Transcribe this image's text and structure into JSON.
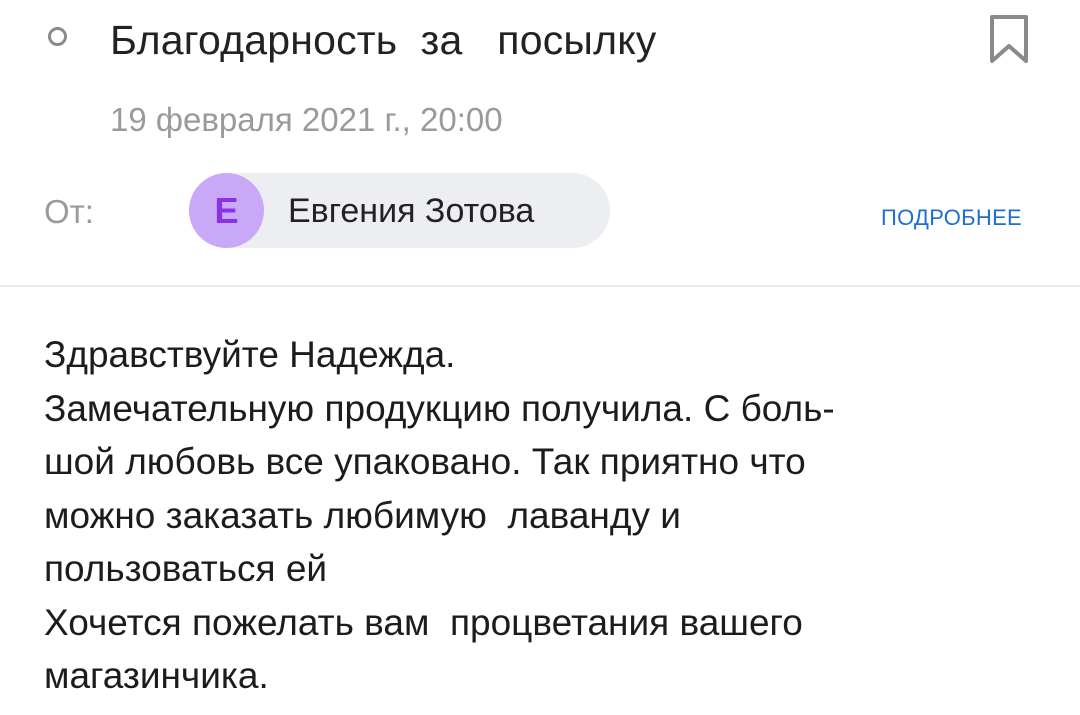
{
  "message": {
    "subject": "Благодарность  за   посылку",
    "date": "19 февраля 2021 г., 20:00",
    "from_label": "От:",
    "sender": {
      "initial": "Е",
      "name": "Евгения Зотова",
      "avatar_color": "#c9a9f7",
      "initial_color": "#8b32e8"
    },
    "details_label": "ПОДРОБНЕЕ",
    "icons": {
      "unread": "unread-circle-icon",
      "bookmark": "bookmark-icon"
    },
    "body_lines": [
      "Здравствуйте Надежда.",
      "Замечательную продукцию получила. С боль-",
      "шой любовь все упаковано. Так приятно что",
      "можно заказать любимую  лаванду и",
      "пользоваться ей",
      "Хочется пожелать вам  процветания вашего",
      "магазинчика."
    ]
  },
  "colors": {
    "accent_link": "#1f6fd1",
    "muted_text": "#9a9a9a",
    "chip_background": "#eceef1"
  }
}
